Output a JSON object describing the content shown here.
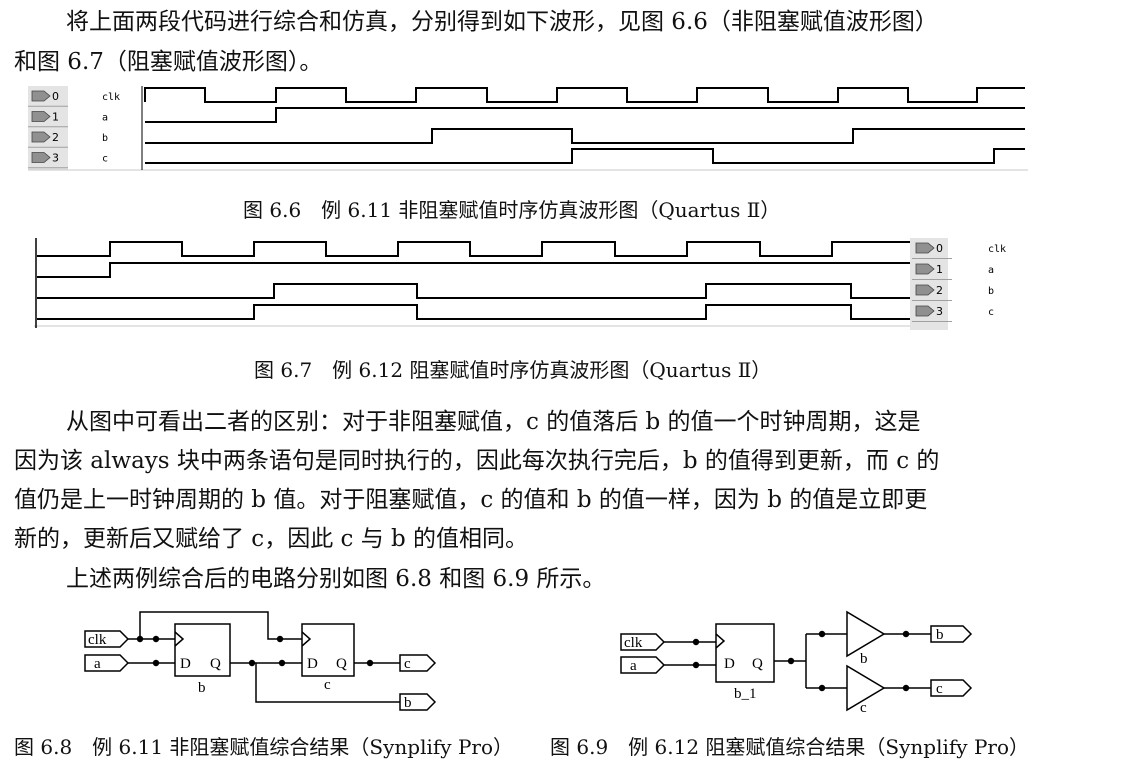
{
  "paragraphs": {
    "p1_line1": "将上面两段代码进行综合和仿真，分别得到如下波形，见图 6.6（非阻塞赋值波形图）",
    "p1_line2": "和图 6.7（阻塞赋值波形图）。",
    "p2_line1": "从图中可看出二者的区别：对于非阻塞赋值，c 的值落后 b 的值一个时钟周期，这是",
    "p2_line2": "因为该 always 块中两条语句是同时执行的，因此每次执行完后，b 的值得到更新，而 c 的",
    "p2_line3": "值仍是上一时钟周期的 b 值。对于阻塞赋值，c 的值和 b 的值一样，因为 b 的值是立即更",
    "p2_line4": "新的，更新后又赋给了 c，因此 c 与 b 的值相同。",
    "p3_line1": "上述两例综合后的电路分别如图 6.8 和图 6.9 所示。"
  },
  "figures": {
    "fig66": {
      "caption": "图 6.6　例 6.11 非阻塞赋值时序仿真波形图（Quartus Ⅱ）",
      "signals": [
        {
          "index": "0",
          "name": "clk"
        },
        {
          "index": "1",
          "name": "a"
        },
        {
          "index": "2",
          "name": "b"
        },
        {
          "index": "3",
          "name": "c"
        }
      ]
    },
    "fig67": {
      "caption": "图 6.7　例 6.12 阻塞赋值时序仿真波形图（Quartus Ⅱ）",
      "signals": [
        {
          "index": "0",
          "name": "clk"
        },
        {
          "index": "1",
          "name": "a"
        },
        {
          "index": "2",
          "name": "b"
        },
        {
          "index": "3",
          "name": "c"
        }
      ]
    },
    "fig68": {
      "caption": "图 6.8　例 6.11 非阻塞赋值综合结果（Synplify Pro）",
      "ports": {
        "clk": "clk",
        "a": "a",
        "c": "c",
        "b": "b"
      },
      "ff1": {
        "d": "D",
        "q": "Q",
        "name": "b"
      },
      "ff2": {
        "d": "D",
        "q": "Q",
        "name": "c"
      }
    },
    "fig69": {
      "caption": "图 6.9　例 6.12 阻塞赋值综合结果（Synplify Pro）",
      "ports": {
        "clk": "clk",
        "a": "a",
        "b": "b",
        "c": "c"
      },
      "ff": {
        "d": "D",
        "q": "Q",
        "name": "b_1"
      },
      "buf_b": "b",
      "buf_c": "c"
    }
  }
}
